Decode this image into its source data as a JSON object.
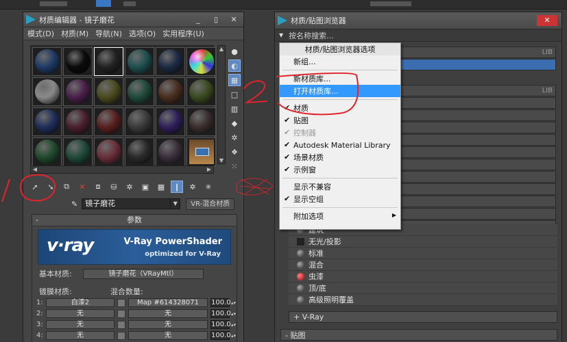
{
  "material_editor": {
    "title": "材质编辑器 - 镜子磨花",
    "title_buttons": [
      "_",
      "▯",
      "✕"
    ],
    "menu": [
      "模式(D)",
      "材质(M)",
      "导航(N)",
      "选项(O)",
      "实用程序(U)"
    ],
    "slot_colors": [
      "#1f3a66",
      "#0a0a0a",
      "#222222",
      "#1f4f4f",
      "#1d2a44",
      "tex",
      "#8a8a8a",
      "#4a1f4a",
      "#4a4a1f",
      "#1f4a3a",
      "#4a2e1f",
      "#3a4a1f",
      "#1f2e5a",
      "#4a1f2e",
      "#5a1f1f",
      "#3a3a3a",
      "#2e1f5a",
      "#3a2e2e",
      "#1f4a2e",
      "#1f4a3a",
      "#6a2e3a",
      "#2a2a2a",
      "#3a2e3a",
      "room"
    ],
    "material_name": "镜子磨花",
    "material_type": "VR-混合材质",
    "params_title": "参数",
    "vray_logo": "v·ray",
    "vray_product": "V-Ray PowerShader",
    "vray_tagline": "optimized for V-Ray",
    "base_label": "基本材质:",
    "base_value": "镜子磨花（VRayMtl）",
    "coat_label": "镀膜材质:",
    "blend_label": "混合数量:",
    "coats": [
      {
        "n": "1:",
        "mat": "白漆2",
        "map": "Map #614328071",
        "amt": "100.0"
      },
      {
        "n": "2:",
        "mat": "无",
        "map": "无",
        "amt": "100.0"
      },
      {
        "n": "3:",
        "mat": "无",
        "map": "无",
        "amt": "100.0"
      },
      {
        "n": "4:",
        "mat": "无",
        "map": "无",
        "amt": "100.0"
      }
    ]
  },
  "browser": {
    "title": "材质/贴图浏览器",
    "close_label": "✕",
    "search_placeholder": "按名称搜索...",
    "lib_label": "LIB",
    "context_menu": {
      "header": "材质/贴图浏览器选项",
      "items": [
        {
          "label": "新组...",
          "check": "",
          "state": ""
        },
        {
          "label": "新材质库...",
          "check": "",
          "state": ""
        },
        {
          "label": "打开材质库...",
          "check": "",
          "state": "hl"
        },
        {
          "label": "材质",
          "check": "✔",
          "state": ""
        },
        {
          "label": "贴图",
          "check": "✔",
          "state": ""
        },
        {
          "label": "控制器",
          "check": "✔",
          "state": "dis"
        },
        {
          "label": "Autodesk Material Library",
          "check": "✔",
          "state": ""
        },
        {
          "label": "场景材质",
          "check": "✔",
          "state": ""
        },
        {
          "label": "示例窗",
          "check": "✔",
          "state": ""
        },
        {
          "label": "显示不兼容",
          "check": "",
          "state": ""
        },
        {
          "label": "显示空组",
          "check": "✔",
          "state": ""
        },
        {
          "label": "附加选项",
          "check": "",
          "state": "",
          "submenu": "▶"
        }
      ]
    },
    "material_items": [
      {
        "label": "建筑",
        "icon": "ball"
      },
      {
        "label": "无光/投影",
        "icon": "square"
      },
      {
        "label": "标准",
        "icon": "ball"
      },
      {
        "label": "混合",
        "icon": "ball"
      },
      {
        "label": "虫漆",
        "icon": "ball-red"
      },
      {
        "label": "顶/底",
        "icon": "ball"
      },
      {
        "label": "高级照明覆盖",
        "icon": "ball"
      }
    ],
    "vray_group": "+ V-Ray",
    "maps_group": "- 贴图"
  },
  "annotations": {
    "number_two": "2"
  },
  "colors": {
    "highlight": "#3399ff",
    "annotation_red": "#e0242b",
    "vray_blue": "#2b5e9a"
  }
}
